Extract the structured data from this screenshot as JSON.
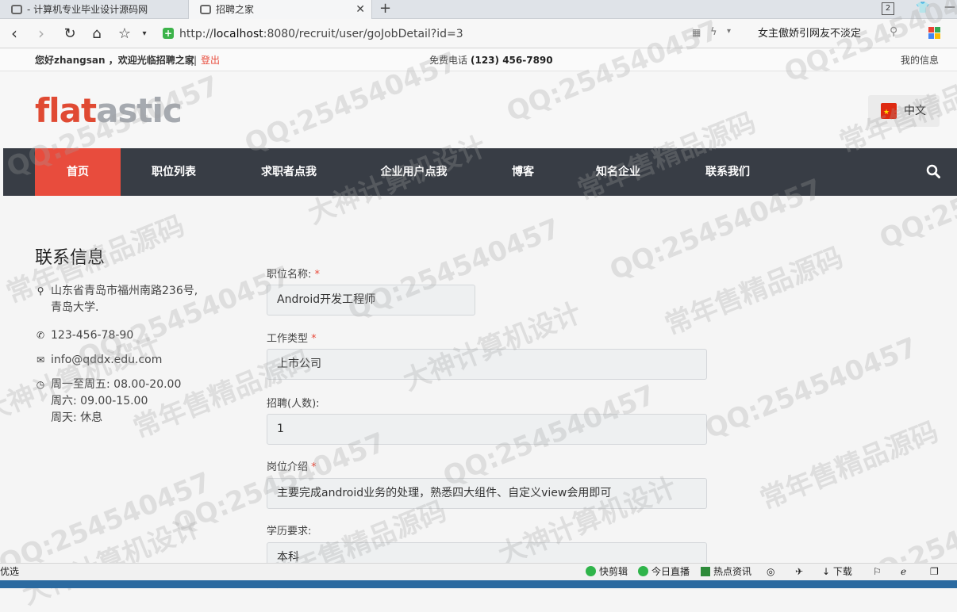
{
  "browser": {
    "tabs": [
      {
        "label": "- 计算机专业毕业设计源码网"
      },
      {
        "label": "招聘之家"
      }
    ],
    "tab_count": "2",
    "url_prefix": "http://",
    "url_host": "localhost",
    "url_rest": ":8080/recruit/user/goJobDetail?id=3",
    "search_text": "女主傲娇引网友不淡定"
  },
  "topbar": {
    "greeting": "您好zhangsan ，欢迎光临招聘之家",
    "separator": " || ",
    "logout": "登出",
    "phone_label": "免费电话",
    "phone": "(123) 456-7890",
    "my_info": "我的信息"
  },
  "header": {
    "logo_part1": "flat",
    "logo_part2": "astic",
    "lang": "中文"
  },
  "nav": {
    "items": [
      "首页",
      "职位列表",
      "求职者点我",
      "企业用户点我",
      "博客",
      "知名企业",
      "联系我们"
    ]
  },
  "contact": {
    "title": "联系信息",
    "address_line1": "山东省青岛市福州南路236号,",
    "address_line2": "青岛大学.",
    "phone": "123-456-78-90",
    "email": "info@qddx.edu.com",
    "hours1": "周一至周五: 08.00-20.00",
    "hours2": "周六: 09.00-15.00",
    "hours3": "周天: 休息"
  },
  "form": {
    "job_name_label": "职位名称:",
    "job_name_value": "Android开发工程师",
    "job_type_label": "工作类型",
    "job_type_value": "上市公司",
    "recruit_label": "招聘(人数):",
    "recruit_value": "1",
    "intro_label": "岗位介绍",
    "intro_value": "主要完成android业务的处理，熟悉四大组件、自定义view会用即可",
    "edu_label": "学历要求:",
    "edu_value": "本科",
    "required_mark": "*"
  },
  "statusbar": {
    "left": "优选",
    "items": [
      "快剪辑",
      "今日直播",
      "热点资讯",
      "下载"
    ]
  },
  "watermarks": [
    "QQ:254540457",
    "常年售精品源码",
    "大神计算机设计"
  ]
}
